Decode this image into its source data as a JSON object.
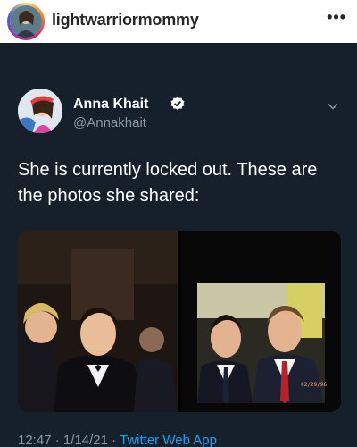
{
  "instagram": {
    "username": "lightwarriormommy",
    "more_label": "•••"
  },
  "tweet": {
    "author_name": "Anna Khait",
    "handle": "@Annakhait",
    "text": "She is currently locked out. These are the photos she shared:",
    "time": "12:47",
    "separator": " · ",
    "date": "1/14/21",
    "app": "Twitter Web App",
    "photo_date_stamp": "02/29/96"
  },
  "colors": {
    "tweet_bg": "#15202b",
    "secondary_text": "#8899a6",
    "link": "#1da1f2",
    "verified": "#1da1f2"
  }
}
